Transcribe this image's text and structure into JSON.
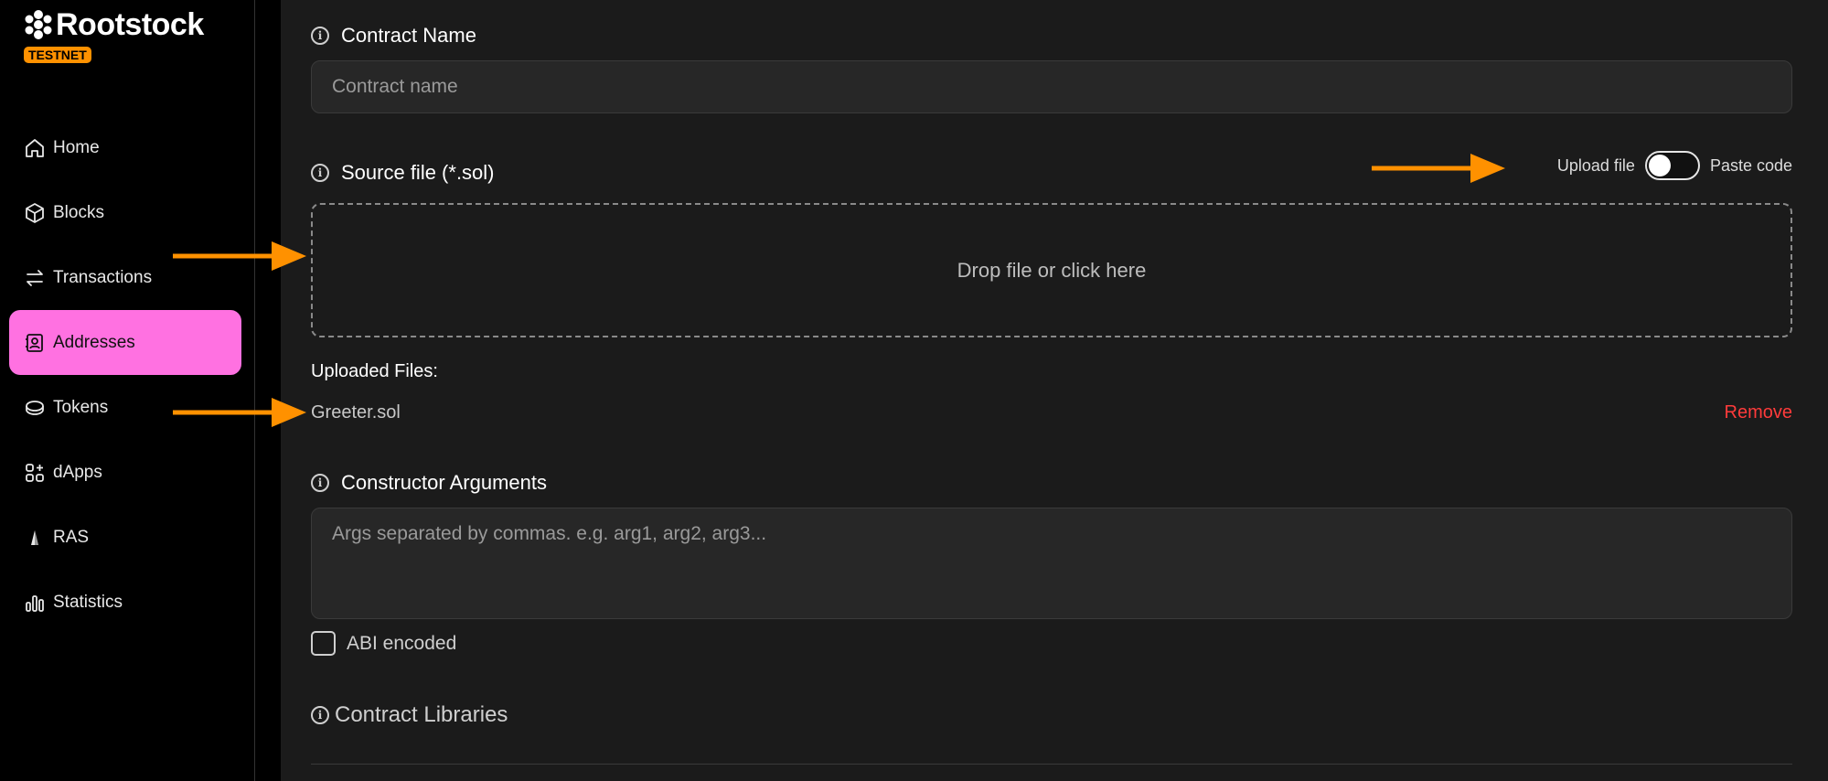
{
  "brand": {
    "name": "Rootstock",
    "network_badge": "TESTNET",
    "badge_color": "#ff9100"
  },
  "sidebar": {
    "items": [
      {
        "label": "Home",
        "icon": "home-icon",
        "active": false
      },
      {
        "label": "Blocks",
        "icon": "cube-icon",
        "active": false
      },
      {
        "label": "Transactions",
        "icon": "arrows-swap-icon",
        "active": false
      },
      {
        "label": "Addresses",
        "icon": "contact-card-icon",
        "active": true
      },
      {
        "label": "Tokens",
        "icon": "coin-icon",
        "active": false
      },
      {
        "label": "dApps",
        "icon": "apps-grid-icon",
        "active": false
      },
      {
        "label": "RAS",
        "icon": "ras-icon",
        "active": false
      },
      {
        "label": "Statistics",
        "icon": "bar-chart-icon",
        "active": false
      }
    ],
    "active_color": "#ff71e1"
  },
  "form": {
    "contract_name": {
      "label": "Contract Name",
      "placeholder": "Contract name",
      "value": ""
    },
    "source_file": {
      "label": "Source file (*.sol)",
      "toggle_left": "Upload file",
      "toggle_right": "Paste code",
      "dropzone_text": "Drop file or click here"
    },
    "uploaded": {
      "title": "Uploaded Files:",
      "files": [
        {
          "name": "Greeter.sol",
          "remove_label": "Remove"
        }
      ]
    },
    "constructor_args": {
      "label": "Constructor Arguments",
      "placeholder": "Args separated by commas. e.g. arg1, arg2, arg3..."
    },
    "abi_encoded": {
      "label": "ABI encoded",
      "checked": false
    },
    "libraries": {
      "label": "Contract Libraries"
    }
  },
  "colors": {
    "annotation_arrow": "#ff9100",
    "remove": "#ff3b3b",
    "main_bg": "#1b1b1b"
  }
}
